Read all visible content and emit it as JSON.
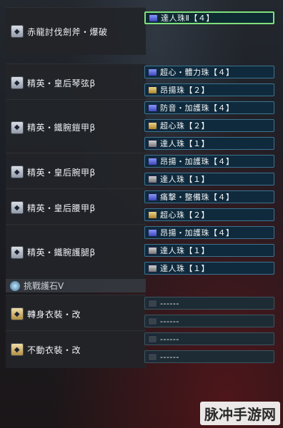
{
  "equipment": [
    {
      "name": "赤龍討伐劍斧・爆破",
      "icon": "sword-axe-icon",
      "slots": [
        {
          "label": "達人珠Ⅱ【４】",
          "gem": "level4",
          "selected": true
        }
      ]
    },
    {
      "name": "精英・皇后琴弦β",
      "icon": "helmet-icon",
      "slots": [
        {
          "label": "超心・體力珠【４】",
          "gem": "level4"
        },
        {
          "label": "昂揚珠【２】",
          "gem": "level2"
        }
      ]
    },
    {
      "name": "精英・鐵腕鎧甲β",
      "icon": "chest-armor-icon",
      "slots": [
        {
          "label": "防音・加護珠【４】",
          "gem": "level4"
        },
        {
          "label": "超心珠【２】",
          "gem": "level2"
        },
        {
          "label": "達人珠【１】",
          "gem": "level1"
        }
      ]
    },
    {
      "name": "精英・皇后腕甲β",
      "icon": "arm-armor-icon",
      "slots": [
        {
          "label": "昂揚・加護珠【４】",
          "gem": "level4"
        },
        {
          "label": "達人珠【１】",
          "gem": "level1"
        }
      ]
    },
    {
      "name": "精英・皇后腰甲β",
      "icon": "waist-armor-icon",
      "slots": [
        {
          "label": "痛擊・整備珠【４】",
          "gem": "level4"
        },
        {
          "label": "超心珠【２】",
          "gem": "level2"
        }
      ]
    },
    {
      "name": "精英・鐵腕護腿β",
      "icon": "leg-armor-icon",
      "slots": [
        {
          "label": "昂揚・加護珠【４】",
          "gem": "level4"
        },
        {
          "label": "達人珠【１】",
          "gem": "level1"
        },
        {
          "label": "達人珠【１】",
          "gem": "level1"
        }
      ]
    }
  ],
  "charm": {
    "name": "挑戰護石Ⅴ",
    "icon": "charm-icon"
  },
  "mantles": [
    {
      "name": "轉身衣裝・改",
      "icon": "mantle-icon",
      "slots": [
        {
          "label": "------",
          "gem": "empty"
        },
        {
          "label": "------",
          "gem": "empty"
        }
      ]
    },
    {
      "name": "不動衣裝・改",
      "icon": "mantle-icon",
      "slots": [
        {
          "label": "------",
          "gem": "empty"
        },
        {
          "label": "------",
          "gem": "empty"
        }
      ]
    }
  ],
  "watermark": "脉冲手游网"
}
